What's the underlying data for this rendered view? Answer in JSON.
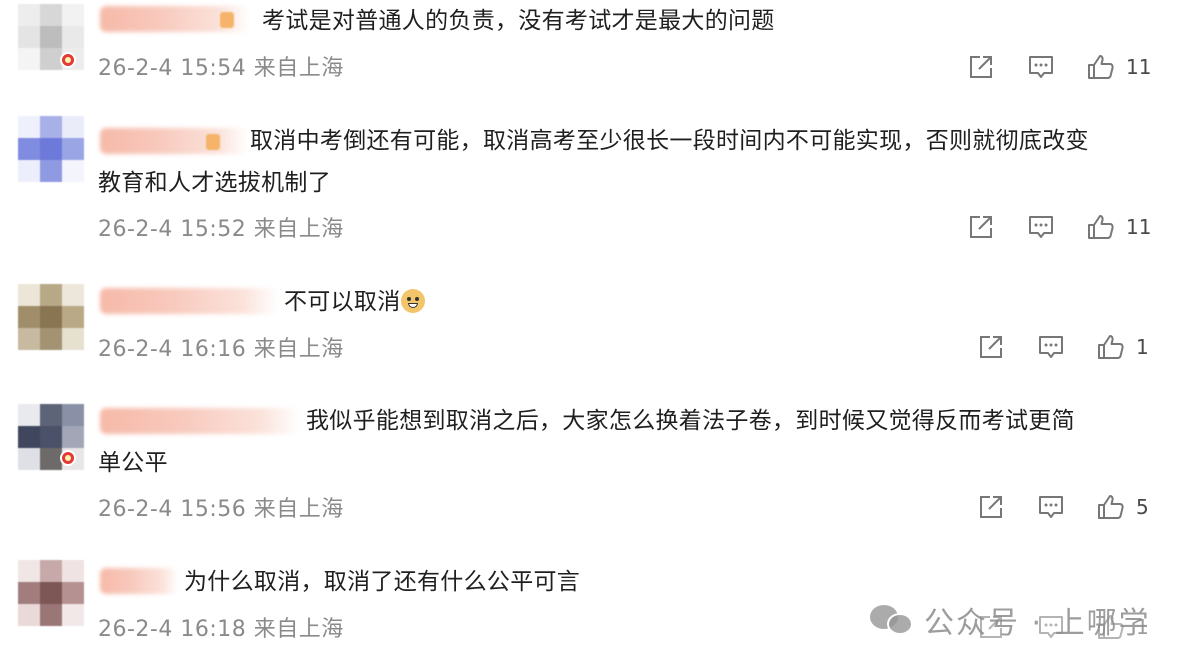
{
  "comments": [
    {
      "text": "考试是对普通人的负责，没有考试才是最大的问题",
      "time": "26-2-4 15:54",
      "location": "来自上海",
      "likes": "11"
    },
    {
      "text_line1": "取消中考倒还有可能，取消高考至少很长一段时间内不可能实现，否则就彻底改变",
      "text_line2": "教育和人才选拔机制了",
      "time": "26-2-4 15:52",
      "location": "来自上海",
      "likes": "11"
    },
    {
      "text": "不可以取消",
      "emoji": "doge-emoji",
      "time": "26-2-4 16:16",
      "location": "来自上海",
      "likes": "1"
    },
    {
      "text_line1": "我似乎能想到取消之后，大家怎么换着法子卷，到时候又觉得反而考试更简",
      "text_line2": "单公平",
      "time": "26-2-4 15:56",
      "location": "来自上海",
      "likes": "5"
    },
    {
      "text": "为什么取消，取消了还有什么公平可言",
      "time": "26-2-4 16:18",
      "location": "来自上海",
      "likes": "1"
    }
  ],
  "watermark": {
    "text": "公众号 · 上哪学",
    "icon": "wechat-icon"
  },
  "icons": {
    "share": "share-icon",
    "reply": "comment-icon",
    "like": "thumbs-up-icon"
  },
  "colors": {
    "text": "#1f1f1f",
    "meta": "#8a8a8a",
    "badge": "#e53935"
  }
}
